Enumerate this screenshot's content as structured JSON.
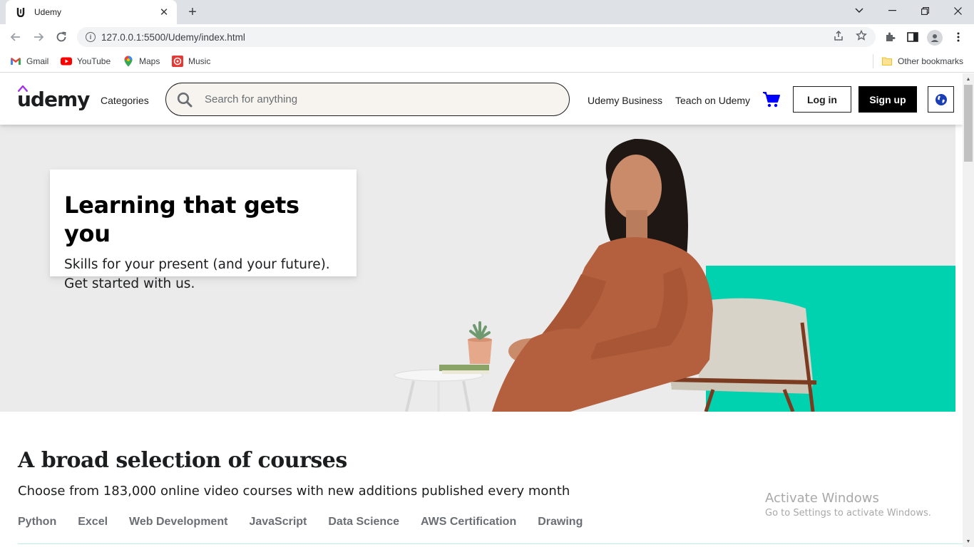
{
  "browser": {
    "tab_title": "Udemy",
    "tab_close": "✕",
    "new_tab": "+",
    "url": "127.0.0.1:5500/Udemy/index.html",
    "window_controls": {
      "minimize_icon": "minimize",
      "restore_icon": "restore",
      "close_icon": "close",
      "tabsearch_icon": "chevron-down"
    },
    "bookmarks": [
      {
        "label": "Gmail",
        "icon": "gmail"
      },
      {
        "label": "YouTube",
        "icon": "youtube"
      },
      {
        "label": "Maps",
        "icon": "maps"
      },
      {
        "label": "Music",
        "icon": "music"
      }
    ],
    "other_bookmarks": "Other bookmarks"
  },
  "header": {
    "logo": "udemy",
    "categories": "Categories",
    "search_placeholder": "Search for anything",
    "udemy_business": "Udemy Business",
    "teach": "Teach on Udemy",
    "login": "Log in",
    "signup": "Sign up",
    "cart_icon": "cart",
    "lang_icon": "globe"
  },
  "hero": {
    "title": "Learning that gets you",
    "subtitle": "Skills for your present (and your future). Get started with us."
  },
  "courses": {
    "title": "A broad selection of courses",
    "subtitle": "Choose from 183,000 online video courses with new additions published every month",
    "tabs": [
      "Python",
      "Excel",
      "Web Development",
      "JavaScript",
      "Data Science",
      "AWS Certification",
      "Drawing"
    ]
  },
  "watermark": {
    "title": "Activate Windows",
    "subtitle": "Go to Settings to activate Windows."
  },
  "colors": {
    "brand_purple": "#a435f0",
    "teal": "#00d1af",
    "cart_blue": "#0000ff",
    "hero_bg": "#ebebeb"
  }
}
